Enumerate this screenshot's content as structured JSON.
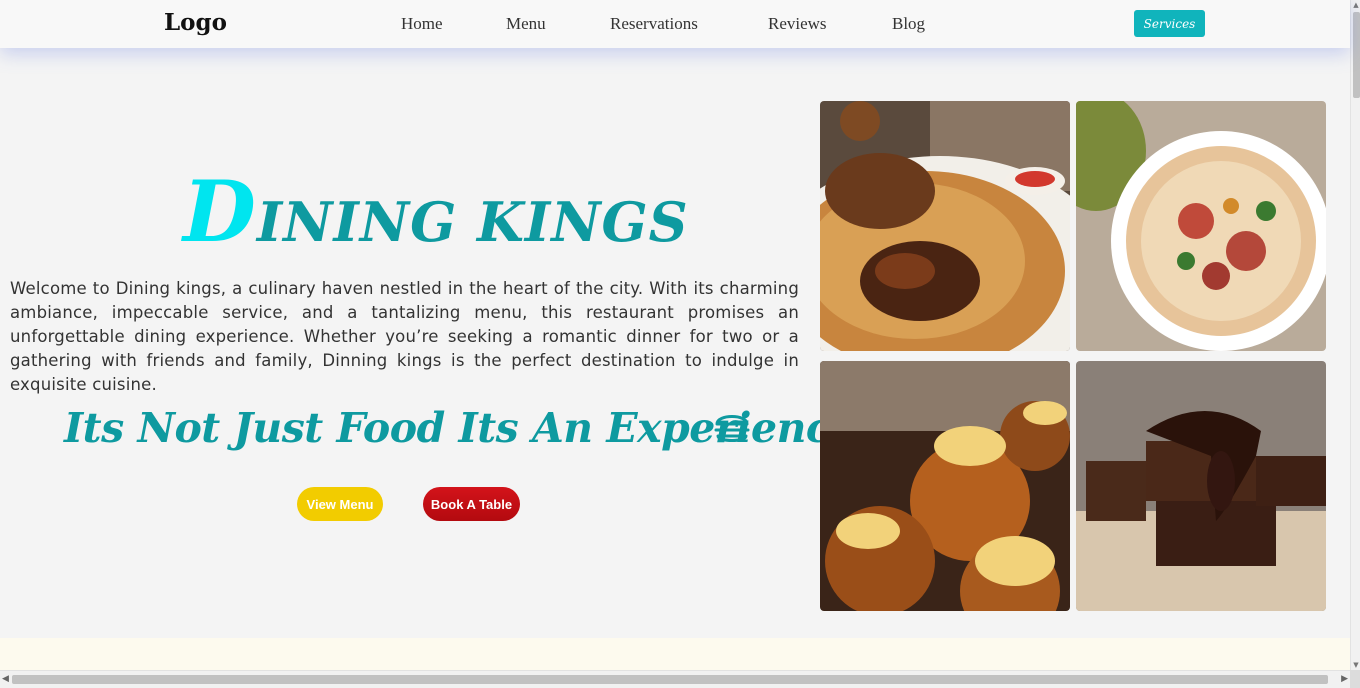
{
  "navbar": {
    "logo": "Logo",
    "links": [
      "Home",
      "Menu",
      "Reservations",
      "Reviews",
      "Blog"
    ],
    "services_label": "Services"
  },
  "hero": {
    "title_initial": "D",
    "title_rest": "INING KINGS",
    "intro": "Welcome to Dining kings, a culinary haven nestled in the heart of the city. With its charming ambiance, impeccable service, and a tantalizing menu, this restaurant promises an unforgettable dining experience. Whether you’re seeking a romantic dinner for two or a gathering with friends and family, Dinning kings is the perfect destination to indulge in exquisite cuisine.",
    "tagline": "Its Not Just Food Its An Experience!",
    "view_menu_label": "View Menu",
    "book_table_label": "Book A Table"
  },
  "gallery": {
    "images": [
      "biryani-chicken",
      "noodle-soup-bowl",
      "glazed-buns-lemon",
      "chocolate-brownies"
    ]
  },
  "colors": {
    "accent": "#0e9aa0",
    "title_initial": "#00e5ef",
    "services_button": "#10b4bc",
    "view_menu_button": "#f2cc00",
    "book_table_button": "#c20f15"
  }
}
